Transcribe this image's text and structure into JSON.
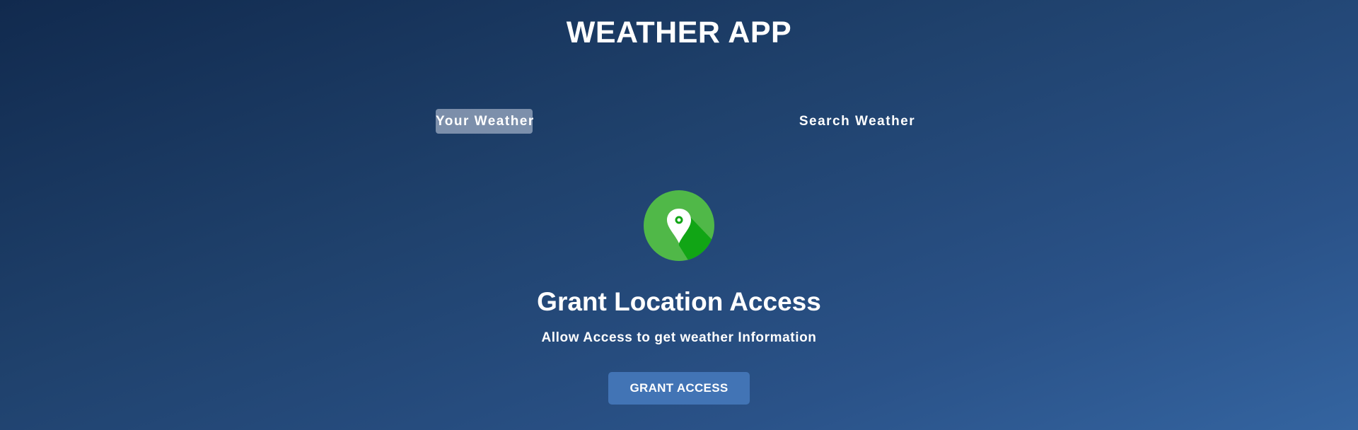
{
  "app": {
    "title": "WEATHER APP"
  },
  "tabs": [
    {
      "label": "Your Weather",
      "active": true
    },
    {
      "label": "Search Weather",
      "active": false
    }
  ],
  "grant": {
    "icon": "location-pin-icon",
    "icon_color": "#50b848",
    "title": "Grant Location Access",
    "subtitle": "Allow Access to get weather Information",
    "button_label": "GRANT ACCESS",
    "button_color": "#4274b5"
  }
}
